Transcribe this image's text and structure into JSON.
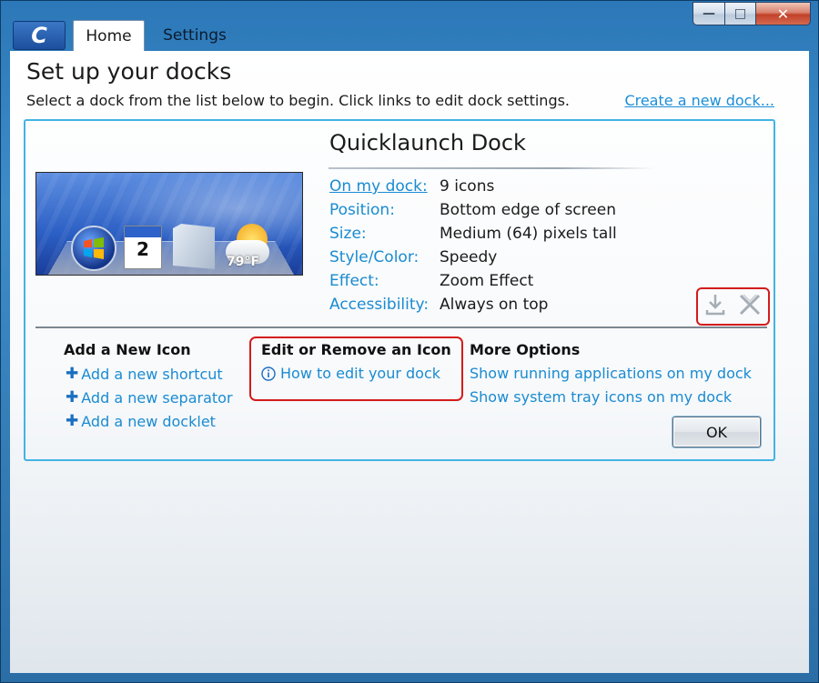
{
  "window": {
    "tabs": {
      "home": "Home",
      "settings": "Settings"
    },
    "logo_glyph": "C",
    "controls": {
      "minimize": "—",
      "maximize": "□",
      "close": "✕"
    }
  },
  "page": {
    "title": "Set up your docks",
    "subtitle": "Select a dock from the list below to begin. Click links to edit dock settings.",
    "create_link": "Create a new dock..."
  },
  "dock": {
    "name": "Quicklaunch Dock",
    "preview": {
      "calendar_day": "2",
      "temperature": "79°F"
    },
    "properties": [
      {
        "label": "On my dock:",
        "value": "9 icons"
      },
      {
        "label": "Position:",
        "value": "Bottom edge of screen"
      },
      {
        "label": "Size:",
        "value": "Medium (64) pixels tall"
      },
      {
        "label": "Style/Color:",
        "value": "Speedy"
      },
      {
        "label": "Effect:",
        "value": "Zoom Effect"
      },
      {
        "label": "Accessibility:",
        "value": "Always on top"
      }
    ],
    "actions": {
      "export_icon": "download-icon",
      "delete_icon": "delete-icon"
    }
  },
  "sections": {
    "add": {
      "heading": "Add a New Icon",
      "links": [
        "Add a new shortcut",
        "Add a new separator",
        "Add a new docklet"
      ]
    },
    "edit": {
      "heading": "Edit or Remove an Icon",
      "links": [
        "How to edit your dock"
      ]
    },
    "more": {
      "heading": "More Options",
      "links": [
        "Show running applications on my dock",
        "Show system tray icons on my dock"
      ]
    }
  },
  "buttons": {
    "ok": "OK"
  },
  "colors": {
    "link": "#1a8bd1",
    "panel_border": "#44b3e4",
    "highlight": "#d41b1b"
  }
}
